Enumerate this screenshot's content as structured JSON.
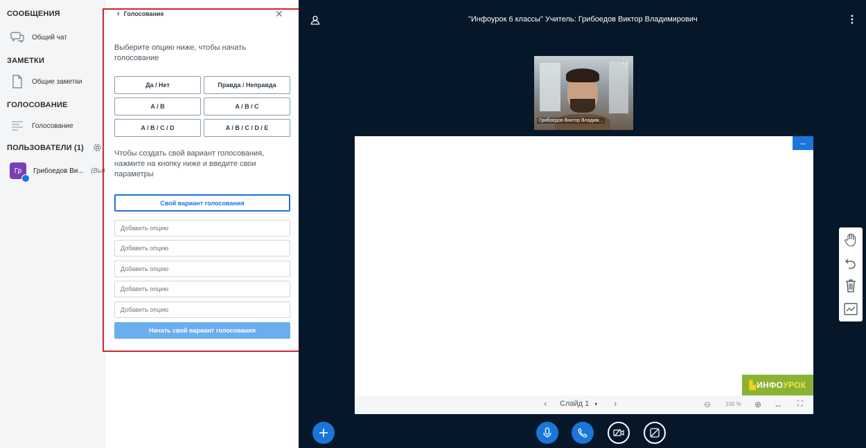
{
  "sidebar": {
    "messages_title": "СООБЩЕНИЯ",
    "public_chat": "Общий чат",
    "notes_title": "ЗАМЕТКИ",
    "shared_notes": "Общие заметки",
    "polling_title": "ГОЛОСОВАНИЕ",
    "polling_item": "Голосование",
    "users_title": "ПОЛЬЗОВАТЕЛИ (1)",
    "user_initials": "Гр",
    "user_name": "Грибоедов Ви...",
    "user_you": "(Вы)"
  },
  "poll": {
    "back_label": "Голосование",
    "instruction": "Выберите опцию ниже, чтобы начать голосование",
    "options": [
      "Да / Нет",
      "Правда / Неправда",
      "A / B",
      "A / B / C",
      "A / B / C / D",
      "A / B / C / D / E"
    ],
    "custom_instruction": "Чтобы создать свой вариант голосования, нажмите на кнопку ниже и введите свои параметры",
    "custom_button": "Свой вариант голосования",
    "add_option_placeholder": "Добавить опцию",
    "start_button": "Начать свой вариант голосования"
  },
  "main": {
    "title": "\"Инфоурок 6 классы\" Учитель: Грибоедов Виктор Владимирович",
    "webcam_name": "Грибоедов Виктор Владим...",
    "slide_label": "Слайд 1",
    "zoom": "100 %",
    "logo_text_a": "ИНФО",
    "logo_text_b": "УРОК"
  },
  "colors": {
    "accent": "#1b76d9",
    "start_button": "#6aaef0",
    "main_bg": "#06172a",
    "outline": "#d3222a",
    "logo_bg": "#8bb233"
  }
}
